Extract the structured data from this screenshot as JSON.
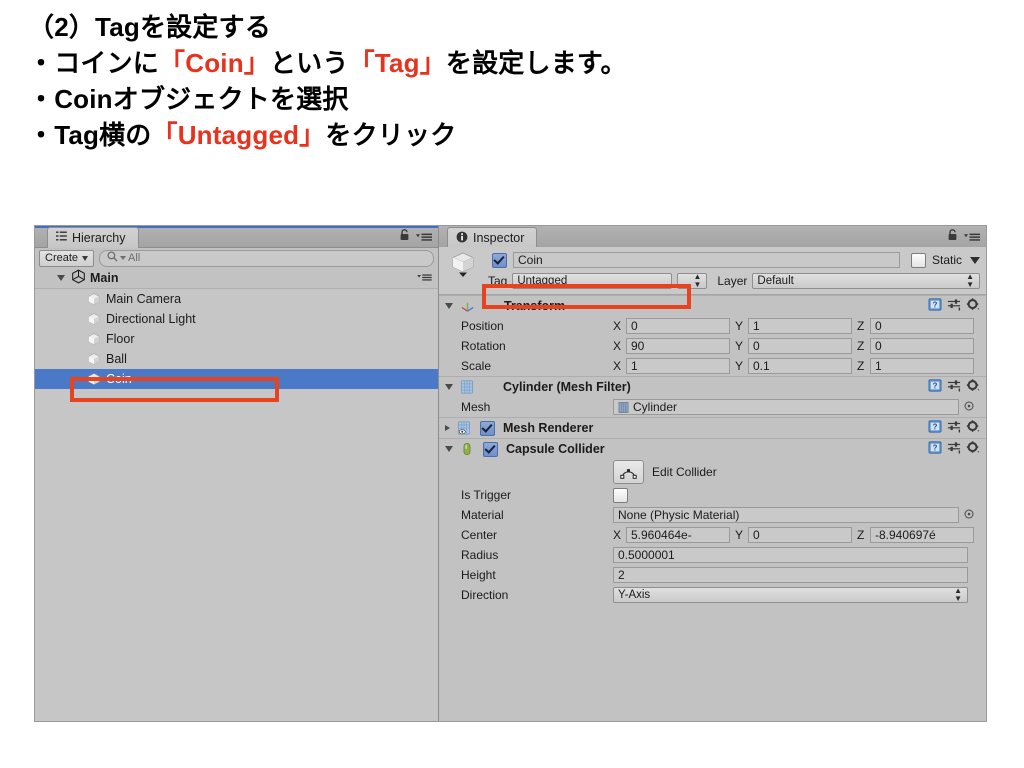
{
  "slide": {
    "lines": [
      [
        {
          "t": "（2）Tagを設定する",
          "c": "normal"
        }
      ],
      [
        {
          "t": "・コインに",
          "c": "normal"
        },
        {
          "t": "「Coin」",
          "c": "hl"
        },
        {
          "t": "という",
          "c": "normal"
        },
        {
          "t": "「Tag」",
          "c": "hl"
        },
        {
          "t": "を設定します。",
          "c": "normal"
        }
      ],
      [
        {
          "t": "・Coinオブジェクトを選択",
          "c": "normal"
        }
      ],
      [
        {
          "t": "・Tag横の",
          "c": "normal"
        },
        {
          "t": "「Untagged」",
          "c": "hl"
        },
        {
          "t": "をクリック",
          "c": "normal"
        }
      ]
    ],
    "highlight_color": "#e8321e"
  },
  "hierarchy": {
    "tab_label": "Hierarchy",
    "tab_icon": "hierarchy-icon",
    "lock_icon": "lock-icon",
    "menu_icon": "panel-menu-icon",
    "create_label": "Create",
    "search_placeholder": "All",
    "search_icon": "search-icon",
    "root": {
      "label": "Main",
      "icon": "unity-logo-icon"
    },
    "items": [
      {
        "label": "Main Camera",
        "icon": "gameobject-cube-icon",
        "selected": false
      },
      {
        "label": "Directional Light",
        "icon": "gameobject-cube-icon",
        "selected": false
      },
      {
        "label": "Floor",
        "icon": "gameobject-cube-icon",
        "selected": false
      },
      {
        "label": "Ball",
        "icon": "gameobject-cube-icon",
        "selected": false
      },
      {
        "label": "Coin",
        "icon": "gameobject-cube-icon",
        "selected": true
      }
    ],
    "selection_color": "#4a7ac7"
  },
  "inspector": {
    "tab_label": "Inspector",
    "tab_icon": "info-icon",
    "lock_icon": "lock-icon",
    "menu_icon": "panel-menu-icon",
    "object": {
      "icon": "prefab-cube-icon",
      "enabled": true,
      "name": "Coin",
      "static_label": "Static",
      "static_checked": false,
      "tag_label": "Tag",
      "tag_value": "Untagged",
      "layer_label": "Layer",
      "layer_value": "Default"
    },
    "components": [
      {
        "title": "Transform",
        "icon": "transform-axis-icon",
        "expanded": true,
        "has_checkbox": false,
        "rows": [
          {
            "label": "Position",
            "type": "vector3",
            "x": "0",
            "y": "1",
            "z": "0"
          },
          {
            "label": "Rotation",
            "type": "vector3",
            "x": "90",
            "y": "0",
            "z": "0"
          },
          {
            "label": "Scale",
            "type": "vector3",
            "x": "1",
            "y": "0.1",
            "z": "1"
          }
        ]
      },
      {
        "title": "Cylinder (Mesh Filter)",
        "icon": "mesh-filter-icon",
        "expanded": true,
        "has_checkbox": false,
        "rows": [
          {
            "label": "Mesh",
            "type": "object-field",
            "value": "Cylinder",
            "value_icon": "mesh-asset-icon"
          }
        ]
      },
      {
        "title": "Mesh Renderer",
        "icon": "mesh-renderer-icon",
        "expanded": false,
        "has_checkbox": true,
        "checked": true,
        "rows": []
      },
      {
        "title": "Capsule Collider",
        "icon": "capsule-collider-icon",
        "expanded": true,
        "has_checkbox": true,
        "checked": true,
        "edit_collider": {
          "label": "Edit Collider",
          "icon": "edit-collider-icon"
        },
        "rows": [
          {
            "label": "Is Trigger",
            "type": "checkbox",
            "checked": false
          },
          {
            "label": "Material",
            "type": "object-field",
            "value": "None (Physic Material)"
          },
          {
            "label": "Center",
            "type": "vector3",
            "x": "5.960464e-",
            "y": "0",
            "z": "-8.940697é"
          },
          {
            "label": "Radius",
            "type": "text",
            "value": "0.5000001"
          },
          {
            "label": "Height",
            "type": "text",
            "value": "2"
          },
          {
            "label": "Direction",
            "type": "popup",
            "value": "Y-Axis"
          }
        ]
      }
    ],
    "component_icons": [
      "help-book-icon",
      "preset-icon",
      "gear-icon"
    ]
  },
  "callouts": [
    {
      "name": "coin-hierarchy-highlight",
      "color": "#e8431f"
    },
    {
      "name": "tag-field-highlight",
      "color": "#e8431f"
    }
  ]
}
